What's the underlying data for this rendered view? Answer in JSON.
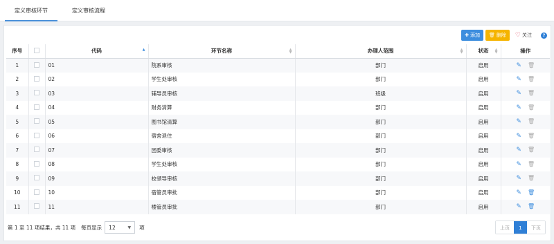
{
  "tabs": [
    {
      "label": "定义审核环节"
    },
    {
      "label": "定义审核流程"
    }
  ],
  "toolbar": {
    "add_label": "添加",
    "delete_label": "删除",
    "follow_label": "关注",
    "help_label": "?",
    "add_color": "#3c8dde",
    "delete_color": "#f5b400"
  },
  "table": {
    "headers": {
      "index": "序号",
      "code": "代码",
      "name": "环节名称",
      "scope": "办理人范围",
      "status": "状态",
      "actions": "操作"
    },
    "rows": [
      {
        "index": "1",
        "code": "01",
        "name": "院系审核",
        "scope": "部门",
        "status": "启用"
      },
      {
        "index": "2",
        "code": "02",
        "name": "学生处审核",
        "scope": "部门",
        "status": "启用"
      },
      {
        "index": "3",
        "code": "03",
        "name": "辅导员审核",
        "scope": "班级",
        "status": "启用"
      },
      {
        "index": "4",
        "code": "04",
        "name": "财务清算",
        "scope": "部门",
        "status": "启用"
      },
      {
        "index": "5",
        "code": "05",
        "name": "图书馆清算",
        "scope": "部门",
        "status": "启用"
      },
      {
        "index": "6",
        "code": "06",
        "name": "宿舍退住",
        "scope": "部门",
        "status": "启用"
      },
      {
        "index": "7",
        "code": "07",
        "name": "团委审核",
        "scope": "部门",
        "status": "启用"
      },
      {
        "index": "8",
        "code": "08",
        "name": "学生处审核",
        "scope": "部门",
        "status": "启用"
      },
      {
        "index": "9",
        "code": "09",
        "name": "校领导审核",
        "scope": "部门",
        "status": "启用"
      },
      {
        "index": "10",
        "code": "10",
        "name": "宿管员审批",
        "scope": "部门",
        "status": "启用"
      },
      {
        "index": "11",
        "code": "11",
        "name": "楼管员审批",
        "scope": "部门",
        "status": "启用"
      }
    ]
  },
  "footer": {
    "summary": "第 1 至 11 项结果，共 11 项",
    "per_page_label": "每页显示",
    "page_size": "12",
    "per_page_suffix": "项"
  },
  "pager": {
    "prev": "上页",
    "current": "1",
    "next": "下页"
  }
}
